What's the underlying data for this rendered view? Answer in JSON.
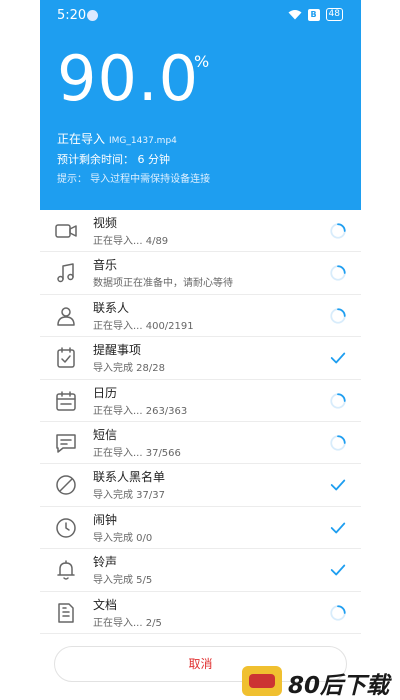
{
  "status": {
    "time": "5:20",
    "battery_badge": "B",
    "battery_level": "48"
  },
  "progress": {
    "value": "90.0",
    "unit": "%"
  },
  "current": {
    "label": "正在导入",
    "file": "IMG_1437.mp4",
    "eta": "预计剩余时间： 6 分钟",
    "hint": "提示： 导入过程中需保持设备连接"
  },
  "items": [
    {
      "icon": "video-icon",
      "title": "视频",
      "subtitle": "正在导入...   4/89",
      "state": "loading"
    },
    {
      "icon": "music-icon",
      "title": "音乐",
      "subtitle": "数据项正在准备中，请耐心等待",
      "state": "loading"
    },
    {
      "icon": "contact-icon",
      "title": "联系人",
      "subtitle": "正在导入...   400/2191",
      "state": "loading"
    },
    {
      "icon": "reminder-icon",
      "title": "提醒事项",
      "subtitle": "导入完成   28/28",
      "state": "done"
    },
    {
      "icon": "calendar-icon",
      "title": "日历",
      "subtitle": "正在导入...   263/363",
      "state": "loading"
    },
    {
      "icon": "message-icon",
      "title": "短信",
      "subtitle": "正在导入...   37/566",
      "state": "loading"
    },
    {
      "icon": "block-icon",
      "title": "联系人黑名单",
      "subtitle": "导入完成   37/37",
      "state": "done"
    },
    {
      "icon": "clock-icon",
      "title": "闹钟",
      "subtitle": "导入完成   0/0",
      "state": "done"
    },
    {
      "icon": "bell-icon",
      "title": "铃声",
      "subtitle": "导入完成   5/5",
      "state": "done"
    },
    {
      "icon": "document-icon",
      "title": "文档",
      "subtitle": "正在导入...   2/5",
      "state": "loading"
    }
  ],
  "cancel_label": "取消",
  "watermark": "80后下载",
  "colors": {
    "accent": "#1e9ef0",
    "cancel": "#e03030",
    "check": "#1e9ef0"
  }
}
